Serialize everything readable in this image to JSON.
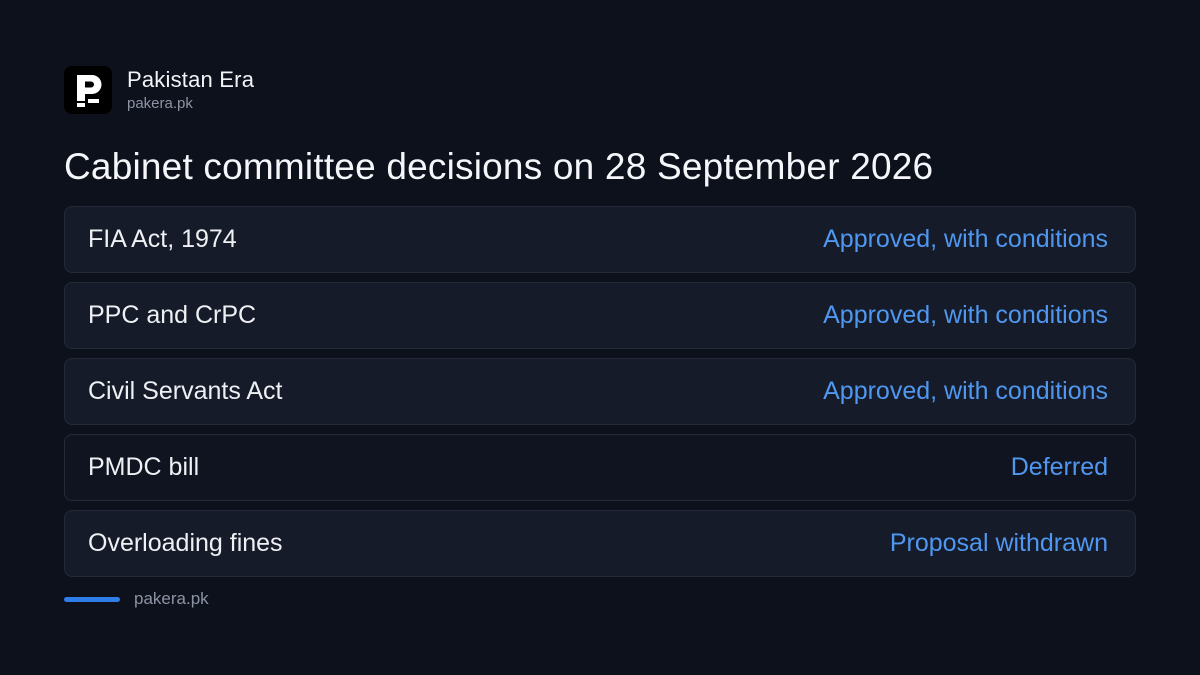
{
  "brand": {
    "name": "Pakistan Era",
    "url": "pakera.pk",
    "logo_icon": "pakistan-era-logo-icon"
  },
  "headline": "Cabinet committee decisions on 28 September 2026",
  "decisions": [
    {
      "item": "FIA Act, 1974",
      "status": "Approved, with conditions"
    },
    {
      "item": "PPC and CrPC",
      "status": "Approved, with conditions"
    },
    {
      "item": "Civil Servants Act",
      "status": "Approved, with conditions"
    },
    {
      "item": "PMDC bill",
      "status": "Deferred"
    },
    {
      "item": "Overloading fines",
      "status": "Proposal withdrawn"
    }
  ],
  "footer": {
    "url": "pakera.pk"
  },
  "colors": {
    "background": "#0d111c",
    "status_text": "#4f97f0",
    "accent_bar": "#2f7de8"
  }
}
